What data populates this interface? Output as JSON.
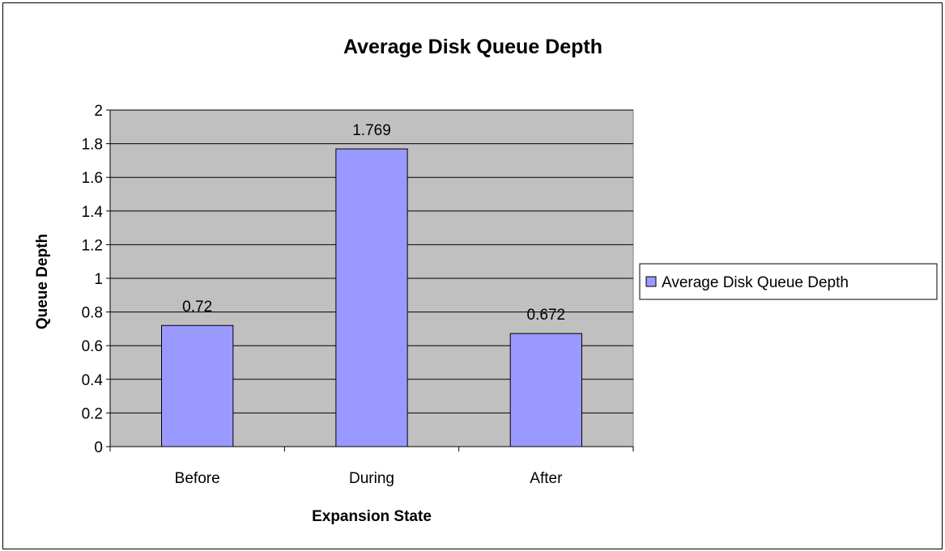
{
  "colors": {
    "plot_background": "#C0C0C0",
    "bar_fill": "#9999FF",
    "bar_stroke": "#000000",
    "gridline": "#000000",
    "background": "#FFFFFF"
  },
  "chart_data": {
    "type": "bar",
    "title": "Average Disk Queue Depth",
    "xlabel": "Expansion State",
    "ylabel": "Queue Depth",
    "categories": [
      "Before",
      "During",
      "After"
    ],
    "series": [
      {
        "name": "Average Disk Queue Depth",
        "values": [
          0.72,
          1.769,
          0.672
        ]
      }
    ],
    "data_labels": [
      "0.72",
      "1.769",
      "0.672"
    ],
    "ylim": [
      0,
      2
    ],
    "yticks": [
      "0",
      "0.2",
      "0.4",
      "0.6",
      "0.8",
      "1",
      "1.2",
      "1.4",
      "1.6",
      "1.8",
      "2"
    ],
    "grid": true,
    "legend_position": "right"
  }
}
